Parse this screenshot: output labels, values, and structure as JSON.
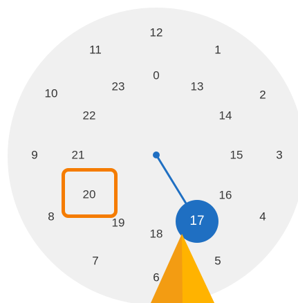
{
  "clock": {
    "outer": [
      "12",
      "1",
      "2",
      "3",
      "4",
      "5",
      "6",
      "7",
      "8",
      "9",
      "10",
      "11"
    ],
    "inner": [
      "0",
      "13",
      "14",
      "15",
      "16",
      "17",
      "18",
      "19",
      "20",
      "21",
      "22",
      "23"
    ],
    "selected": "17",
    "highlighted": "20"
  },
  "colors": {
    "dial_background": "#f0f0f0",
    "accent": "#1f6fc2",
    "highlight": "#f57c00",
    "cursor": "#f39c12"
  },
  "icons": {
    "cursor": "pointer-cursor-icon"
  }
}
